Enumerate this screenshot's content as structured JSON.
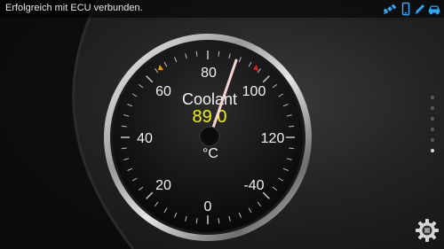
{
  "status_bar": {
    "message": "Erfolgreich mit ECU verbunden.",
    "icons": [
      "satellite-icon",
      "phone-icon",
      "pen-icon",
      "car-icon"
    ],
    "icon_color": "#2aa8ff"
  },
  "gauge": {
    "title": "Coolant",
    "value_text": "89.0",
    "unit": "°C",
    "value": 89.0,
    "scale_labels": [
      "0",
      "20",
      "40",
      "60",
      "80",
      "100",
      "120",
      "-40"
    ],
    "value_color": "#f2f200",
    "needle_color": "#f4d4d4",
    "marker_left_color": "#e8a000",
    "marker_right_color": "#e02020"
  },
  "page_indicator": {
    "count": 6,
    "active_index": 5
  },
  "settings": {
    "icon": "gear-icon"
  }
}
